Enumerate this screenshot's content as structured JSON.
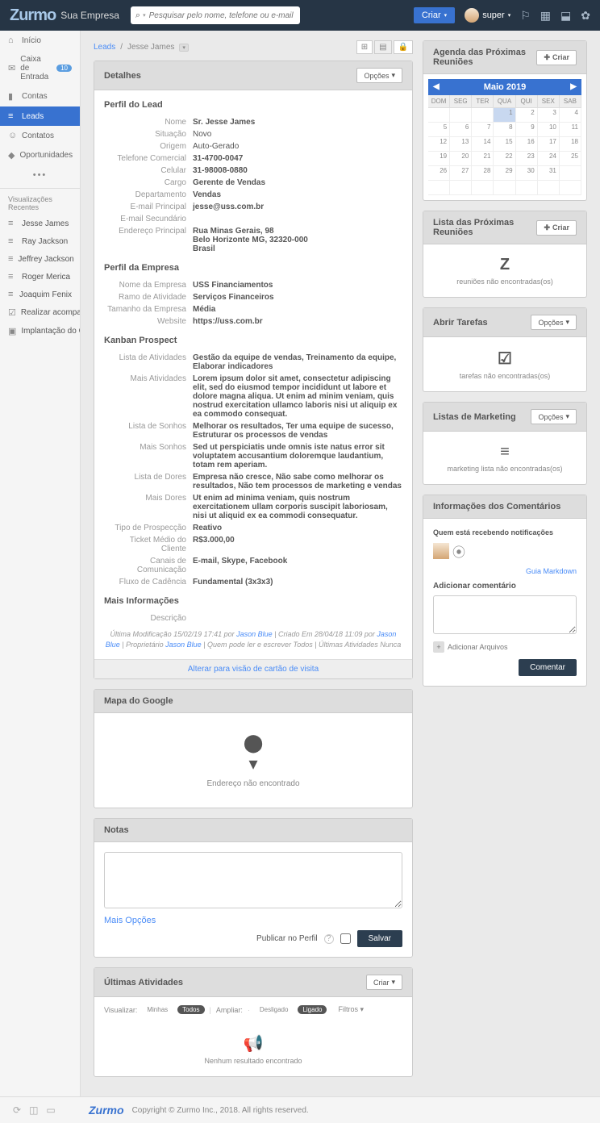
{
  "header": {
    "logo": "Zurmo",
    "company": "Sua Empresa",
    "search_placeholder": "Pesquisar pelo nome, telefone ou e-mail",
    "create_btn": "Criar",
    "user": "super"
  },
  "nav": {
    "inicio": "Início",
    "caixa": "Caixa de Entrada",
    "caixa_badge": "10",
    "contas": "Contas",
    "leads": "Leads",
    "contatos": "Contatos",
    "oportunidades": "Oportunidades"
  },
  "recent": {
    "header": "Visualizações Recentes",
    "items": [
      "Jesse James",
      "Ray Jackson",
      "Jeffrey Jackson",
      "Roger Merica",
      "Joaquim Fenix",
      "Realizar acompan...",
      "Implantação do C..."
    ]
  },
  "breadcrumb": {
    "root": "Leads",
    "current": "Jesse James"
  },
  "details": {
    "title": "Detalhes",
    "opts": "Opções",
    "section_lead": "Perfil do Lead",
    "nome_l": "Nome",
    "nome": "Sr. Jesse James",
    "sit_l": "Situação",
    "sit": "Novo",
    "orig_l": "Origem",
    "orig": "Auto-Gerado",
    "telc_l": "Telefone Comercial",
    "telc": "31-4700-0047",
    "cel_l": "Celular",
    "cel": "31-98008-0880",
    "cargo_l": "Cargo",
    "cargo": "Gerente de Vendas",
    "dept_l": "Departamento",
    "dept": "Vendas",
    "email_l": "E-mail Principal",
    "email": "jesse@uss.com.br",
    "email2_l": "E-mail Secundário",
    "email2": "",
    "addr_l": "Endereço Principal",
    "addr1": "Rua Minas Gerais, 98",
    "addr2": "Belo Horizonte MG, 32320-000",
    "addr3": "Brasil",
    "section_emp": "Perfil da Empresa",
    "emp_l": "Nome da Empresa",
    "emp": "USS Financiamentos",
    "ramo_l": "Ramo de Atividade",
    "ramo": "Serviços Financeiros",
    "tam_l": "Tamanho da Empresa",
    "tam": "Média",
    "web_l": "Website",
    "web": "https://uss.com.br",
    "section_kanban": "Kanban Prospect",
    "la_l": "Lista de Atividades",
    "la": "Gestão da equipe de vendas, Treinamento da equipe, Elaborar indicadores",
    "ma_l": "Mais Atividades",
    "ma": "Lorem ipsum dolor sit amet, consectetur adipiscing elit, sed do eiusmod tempor incididunt ut labore et dolore magna aliqua. Ut enim ad minim veniam, quis nostrud exercitation ullamco laboris nisi ut aliquip ex ea commodo consequat.",
    "ls_l": "Lista de Sonhos",
    "ls": "Melhorar os resultados, Ter uma equipe de sucesso, Estruturar os processos de vendas",
    "ms_l": "Mais Sonhos",
    "ms": "Sed ut perspiciatis unde omnis iste natus error sit voluptatem accusantium doloremque laudantium, totam rem aperiam.",
    "ld_l": "Lista de Dores",
    "ld": "Empresa não cresce, Não sabe como melhorar os resultados, Não tem processos de marketing e vendas",
    "md_l": "Mais Dores",
    "md": "Ut enim ad minima veniam, quis nostrum exercitationem ullam corporis suscipit laboriosam, nisi ut aliquid ex ea commodi consequatur.",
    "tp_l": "Tipo de Prospecção",
    "tp": "Reativo",
    "tm_l": "Ticket Médio do Cliente",
    "tm": "R$3.000,00",
    "cc_l": "Canais de Comunicação",
    "cc": "E-mail, Skype, Facebook",
    "fc_l": "Fluxo de Cadência",
    "fc": "Fundamental (3x3x3)",
    "section_more": "Mais Informações",
    "desc_l": "Descrição",
    "desc": "",
    "meta_prefix": "Última Modificação 15/02/19 17:41 por ",
    "meta_user1": "Jason Blue",
    "meta_mid": " | Criado Em 28/04/18 11:09 por ",
    "meta_user2": "Jason Blue",
    "meta_own": " | Proprietário ",
    "meta_rest": " | Quem pode ler e escrever Todos | Últimas Atividades Nunca",
    "card_link": "Alterar para visão de cartão de visita"
  },
  "map": {
    "title": "Mapa do Google",
    "empty": "Endereço não encontrado"
  },
  "notes": {
    "title": "Notas",
    "more": "Mais Opções",
    "publish": "Publicar no Perfil",
    "save": "Salvar"
  },
  "activities": {
    "title": "Últimas Atividades",
    "criar": "Criar",
    "visualizar": "Visualizar:",
    "minhas": "Minhas",
    "todos": "Todos",
    "ampliar": "Ampliar:",
    "desligado": "Desligado",
    "ligado": "Ligado",
    "filtros": "Filtros",
    "empty": "Nenhum resultado encontrado"
  },
  "agenda": {
    "title": "Agenda das Próximas Reuniões",
    "criar": "Criar",
    "month": "Maio 2019",
    "days": [
      "DOM",
      "SEG",
      "TER",
      "QUA",
      "QUI",
      "SEX",
      "SAB"
    ]
  },
  "meetings": {
    "title": "Lista das Próximas Reuniões",
    "criar": "Criar",
    "empty": "reuniões não encontradas(os)"
  },
  "tasks": {
    "title": "Abrir Tarefas",
    "opts": "Opções",
    "empty": "tarefas não encontradas(os)"
  },
  "marketing": {
    "title": "Listas de Marketing",
    "opts": "Opções",
    "empty": "marketing lista não encontradas(os)"
  },
  "comments": {
    "title": "Informações dos Comentários",
    "notif": "Quem está recebendo notificações",
    "guide": "Guia Markdown",
    "add": "Adicionar comentário",
    "attach": "Adicionar Arquivos",
    "btn": "Comentar"
  },
  "footer": {
    "copy": "Copyright © Zurmo Inc., 2018. All rights reserved."
  }
}
